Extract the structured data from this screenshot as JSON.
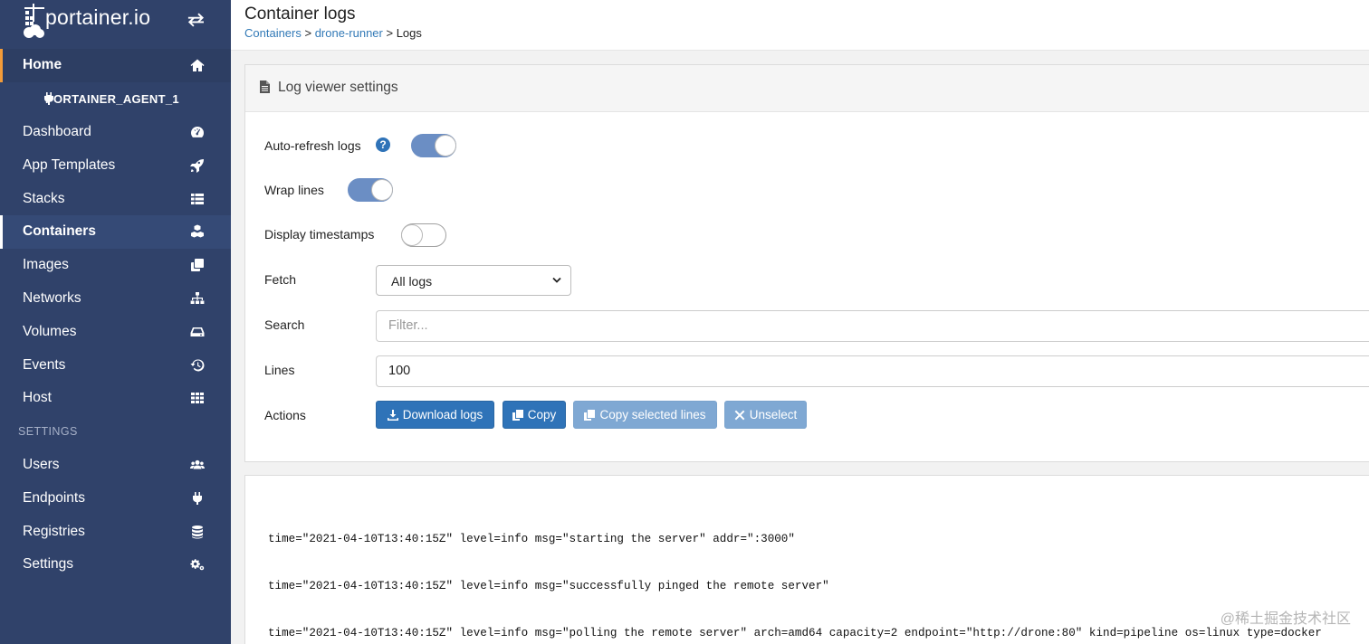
{
  "brand": {
    "name": "portainer.io"
  },
  "sidebar": {
    "home": {
      "label": "Home"
    },
    "endpoint": {
      "label": "PORTAINER_AGENT_1"
    },
    "items": [
      {
        "label": "Dashboard",
        "icon": "tachometer-icon"
      },
      {
        "label": "App Templates",
        "icon": "rocket-icon"
      },
      {
        "label": "Stacks",
        "icon": "th-list-icon"
      },
      {
        "label": "Containers",
        "icon": "cubes-icon",
        "active": true
      },
      {
        "label": "Images",
        "icon": "clone-icon"
      },
      {
        "label": "Networks",
        "icon": "sitemap-icon"
      },
      {
        "label": "Volumes",
        "icon": "hdd-icon"
      },
      {
        "label": "Events",
        "icon": "history-icon"
      },
      {
        "label": "Host",
        "icon": "th-icon"
      }
    ],
    "settings_section": "SETTINGS",
    "settings_items": [
      {
        "label": "Users",
        "icon": "users-icon"
      },
      {
        "label": "Endpoints",
        "icon": "plug-icon"
      },
      {
        "label": "Registries",
        "icon": "database-icon"
      },
      {
        "label": "Settings",
        "icon": "cogs-icon"
      }
    ]
  },
  "header": {
    "title": "Container logs",
    "breadcrumb": {
      "containers": "Containers",
      "sep1": " > ",
      "container": "drone-runner",
      "sep2": " > ",
      "current": "Logs"
    }
  },
  "settings_panel": {
    "title": "Log viewer settings",
    "auto_refresh": {
      "label": "Auto-refresh logs",
      "on": true
    },
    "wrap_lines": {
      "label": "Wrap lines",
      "on": true
    },
    "display_timestamps": {
      "label": "Display timestamps",
      "on": false
    },
    "fetch": {
      "label": "Fetch",
      "value": "All logs"
    },
    "search": {
      "label": "Search",
      "placeholder": "Filter..."
    },
    "lines": {
      "label": "Lines",
      "value": "100"
    },
    "actions": {
      "label": "Actions",
      "download": "Download logs",
      "copy": "Copy",
      "copy_selected": "Copy selected lines",
      "unselect": "Unselect"
    }
  },
  "log_panel": {
    "lines": [
      "time=\"2021-04-10T13:40:15Z\" level=info msg=\"starting the server\" addr=\":3000\"",
      "time=\"2021-04-10T13:40:15Z\" level=info msg=\"successfully pinged the remote server\"",
      "time=\"2021-04-10T13:40:15Z\" level=info msg=\"polling the remote server\" arch=amd64 capacity=2 endpoint=\"http://drone:80\" kind=pipeline os=linux type=docker"
    ]
  },
  "watermark": "@稀土掘金技术社区",
  "colors": {
    "sidebar": "#30426a",
    "accent": "#f29b39",
    "primary": "#2f73b8",
    "toggle_on": "#6b8ec4"
  }
}
